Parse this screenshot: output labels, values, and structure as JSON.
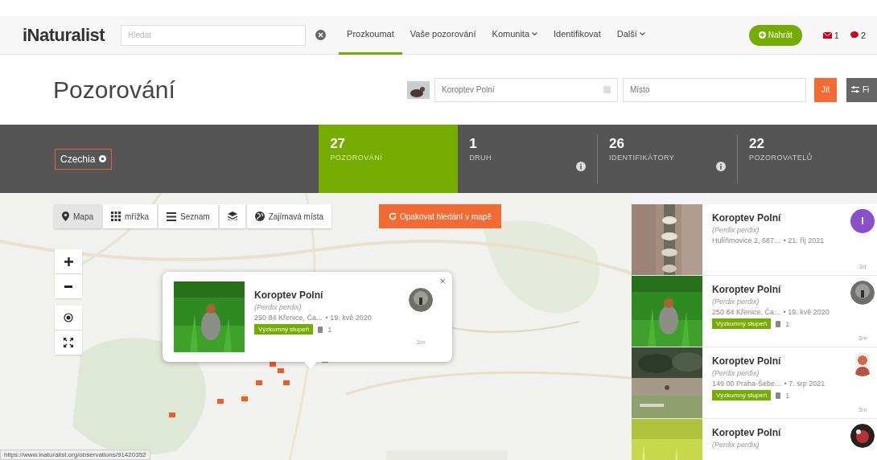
{
  "nav": {
    "logo": "iNaturalist",
    "search_placeholder": "Hledat",
    "items": [
      {
        "label": "Prozkoumat",
        "selected": true,
        "dropdown": false
      },
      {
        "label": "Vaše pozorování",
        "selected": false,
        "dropdown": false
      },
      {
        "label": "Komunita",
        "selected": false,
        "dropdown": true
      },
      {
        "label": "Identifikovat",
        "selected": false,
        "dropdown": false
      },
      {
        "label": "Další",
        "selected": false,
        "dropdown": true
      }
    ],
    "upload_button": "Nahrát",
    "messages": "1",
    "notifications": "2"
  },
  "header": {
    "title": "Pozorování",
    "taxon_value": "Koroptev Polní",
    "place_placeholder": "Místo",
    "go_button": "Jít",
    "filters_button": "Fi"
  },
  "stats": {
    "place_chip": "Czechia",
    "tabs": [
      {
        "count": "27",
        "label": "POZOROVÁNÍ",
        "selected": true,
        "info": false
      },
      {
        "count": "1",
        "label": "DRUH",
        "selected": false,
        "info": true
      },
      {
        "count": "26",
        "label": "IDENTIFIKÁTORY",
        "selected": false,
        "info": true
      },
      {
        "count": "22",
        "label": "POZOROVATELŮ",
        "selected": false,
        "info": false
      }
    ]
  },
  "map": {
    "view_buttons": [
      {
        "kind": "pin",
        "label": "Mapa",
        "selected": true
      },
      {
        "kind": "grid",
        "label": "mřížka",
        "selected": false
      },
      {
        "kind": "list",
        "label": "Seznam",
        "selected": false
      },
      {
        "kind": "layers",
        "selected": false
      },
      {
        "kind": "globe",
        "label": "Zajímavá místa",
        "selected": false
      }
    ],
    "redo_search": "Opakovat hledání v mapě",
    "popup": {
      "close": "×",
      "name": "Koroptev Polní",
      "scientific": "(Perdix perdix)",
      "place": "250 84 Křenice, Ča...",
      "date": "• 19. kvě 2020",
      "quality": "Výzkumný stupeň",
      "ids": "1",
      "time": "3m"
    },
    "status_url": "https://www.inaturalist.org/observations/91420352"
  },
  "observations": [
    {
      "name": "Koroptev Polní",
      "scientific": "(Perdix perdix)",
      "place": "Hulíňmovice 2, 687...",
      "date": "• 21. říj 2021",
      "avatar": {
        "kind": "letter",
        "letter": "I",
        "color": "#8a4fcc"
      },
      "time": "3d"
    },
    {
      "name": "Koroptev Polní",
      "scientific": "(Perdix perdix)",
      "place": "250 84 Křenice, Ča...",
      "date": "• 19. kvě 2020",
      "quality": "Výzkumný stupeň",
      "ids": "1",
      "time": "3m"
    },
    {
      "name": "Koroptev Polní",
      "scientific": "(Perdix perdix)",
      "place": "149 00 Praha-Šebe...",
      "date": "• 7. srp 2021",
      "quality": "Výzkumný stupeň",
      "ids": "1",
      "avatar": {
        "kind": "person"
      },
      "time": "3m"
    },
    {
      "name": "Koroptev Polní",
      "scientific": "(Perdix perdix)",
      "avatar": {
        "kind": "dark"
      }
    }
  ]
}
